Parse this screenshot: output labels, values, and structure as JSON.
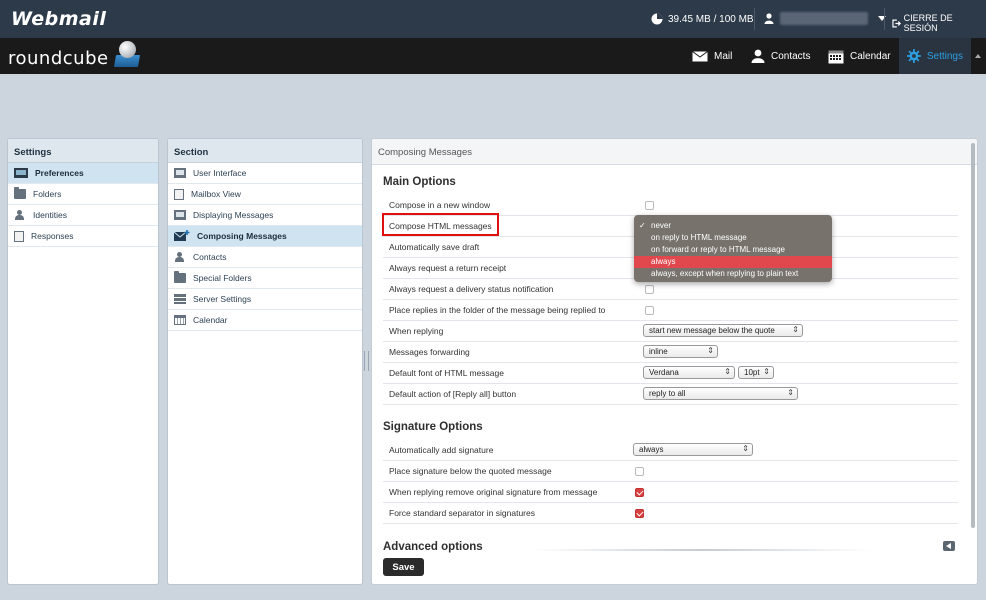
{
  "topbar": {
    "logo": "Webmail",
    "quota": "39.45 MB / 100 MB",
    "logout": "CIERRE DE SESIÓN"
  },
  "navbar": {
    "brand": "roundcube",
    "items": [
      {
        "label": "Mail",
        "icon": "envelope-icon"
      },
      {
        "label": "Contacts",
        "icon": "person-icon"
      },
      {
        "label": "Calendar",
        "icon": "calendar-icon"
      },
      {
        "label": "Settings",
        "icon": "gear-icon",
        "active": true
      }
    ]
  },
  "settings_panel": {
    "title": "Settings",
    "items": [
      {
        "label": "Preferences",
        "icon": "laptop-icon",
        "selected": true
      },
      {
        "label": "Folders",
        "icon": "folder-icon"
      },
      {
        "label": "Identities",
        "icon": "person-icon"
      },
      {
        "label": "Responses",
        "icon": "document-icon"
      }
    ]
  },
  "section_panel": {
    "title": "Section",
    "items": [
      {
        "label": "User Interface",
        "icon": "monitor-icon"
      },
      {
        "label": "Mailbox View",
        "icon": "mailbox-icon"
      },
      {
        "label": "Displaying Messages",
        "icon": "display-icon"
      },
      {
        "label": "Composing Messages",
        "icon": "compose-icon",
        "selected": true
      },
      {
        "label": "Contacts",
        "icon": "person-icon"
      },
      {
        "label": "Special Folders",
        "icon": "folder-icon"
      },
      {
        "label": "Server Settings",
        "icon": "server-icon"
      },
      {
        "label": "Calendar",
        "icon": "calendar-icon"
      }
    ]
  },
  "content": {
    "header": "Composing Messages",
    "main_options_title": "Main Options",
    "main_options": [
      {
        "label": "Compose in a new window",
        "type": "checkbox",
        "checked": false
      },
      {
        "label": "Compose HTML messages",
        "type": "select"
      },
      {
        "label": "Automatically save draft",
        "type": "select"
      },
      {
        "label": "Always request a return receipt",
        "type": "checkbox",
        "checked": false
      },
      {
        "label": "Always request a delivery status notification",
        "type": "checkbox",
        "checked": false
      },
      {
        "label": "Place replies in the folder of the message being replied to",
        "type": "checkbox",
        "checked": false
      },
      {
        "label": "When replying",
        "type": "select",
        "value": "start new message below the quote"
      },
      {
        "label": "Messages forwarding",
        "type": "select",
        "value": "inline"
      },
      {
        "label": "Default font of HTML message",
        "type": "select2",
        "value": "Verdana",
        "value2": "10pt"
      },
      {
        "label": "Default action of [Reply all] button",
        "type": "select",
        "value": "reply to all"
      }
    ],
    "signature_options_title": "Signature Options",
    "signature_options": [
      {
        "label": "Automatically add signature",
        "type": "select",
        "value": "always"
      },
      {
        "label": "Place signature below the quoted message",
        "type": "checkbox",
        "checked": false
      },
      {
        "label": "When replying remove original signature from message",
        "type": "checkbox",
        "checked": true
      },
      {
        "label": "Force standard separator in signatures",
        "type": "checkbox",
        "checked": true
      }
    ],
    "advanced_title": "Advanced options",
    "save_label": "Save"
  },
  "dropdown": {
    "options": [
      {
        "label": "never",
        "checked": true
      },
      {
        "label": "on reply to HTML message"
      },
      {
        "label": "on forward or reply to HTML message"
      },
      {
        "label": "always",
        "highlighted": true
      },
      {
        "label": "always, except when replying to plain text"
      }
    ]
  },
  "colors": {
    "accent": "#2c9ee0",
    "highlight": "#e0484e",
    "topbar": "#2c3a4a",
    "navbar": "#1a1a1a"
  }
}
